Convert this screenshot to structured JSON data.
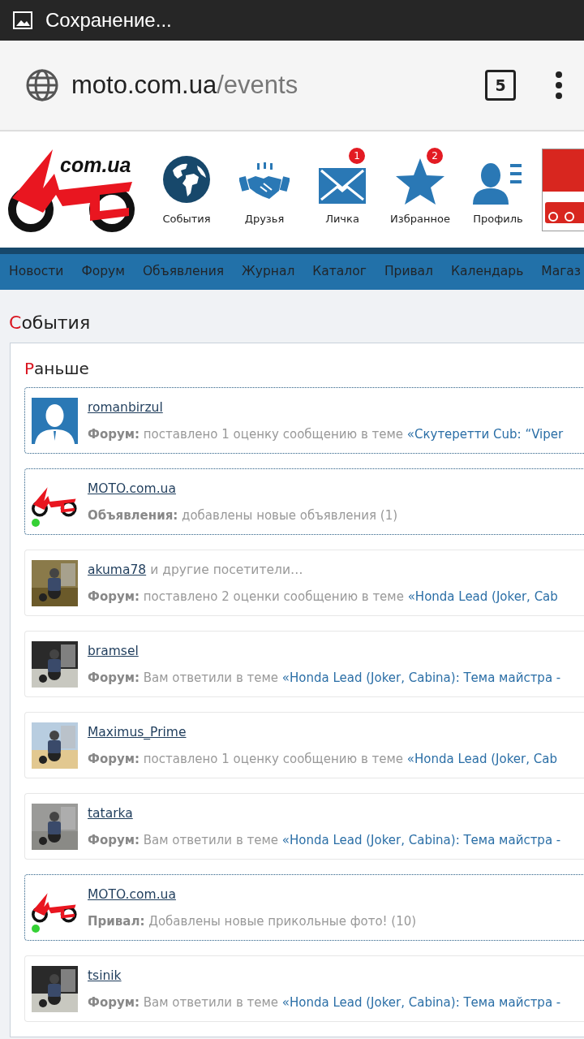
{
  "status_bar": {
    "title": "Сохранение..."
  },
  "address_bar": {
    "host": "moto.com.ua",
    "path": "/events",
    "tab_count": "5"
  },
  "header": {
    "logo_text": "com.ua",
    "items": [
      {
        "label": "События",
        "kind": "globe"
      },
      {
        "label": "Друзья",
        "kind": "handshake"
      },
      {
        "label": "Личка",
        "kind": "envelope",
        "badge": "1"
      },
      {
        "label": "Избранное",
        "kind": "star",
        "badge": "2"
      },
      {
        "label": "Профиль",
        "kind": "profile"
      }
    ]
  },
  "nav": [
    "Новости",
    "Форум",
    "Объявления",
    "Журнал",
    "Каталог",
    "Привал",
    "Календарь",
    "Магаз"
  ],
  "page_title": "События",
  "section_title": "Раньше",
  "events": [
    {
      "kind": "default",
      "online": false,
      "unread": true,
      "user": "romanbirzul",
      "category": "Форум:",
      "text": "поставлено 1 оценку сообщению в теме",
      "link": "«Скутеретти Cub: “Viper"
    },
    {
      "kind": "logo",
      "online": true,
      "unread": true,
      "user": "MOTO.com.ua",
      "category": "Объявления:",
      "text": "добавлены новые объявления (1)"
    },
    {
      "online": false,
      "unread": false,
      "user": "akuma78",
      "suffix": "и другие посетители…",
      "category": "Форум:",
      "text": "поставлено 2 оценки сообщению в теме",
      "link": "«Honda Lead (Joker, Cab"
    },
    {
      "online": false,
      "unread": false,
      "user": "bramsel",
      "category": "Форум:",
      "text": "Вам ответили в теме",
      "link": "«Honda Lead (Joker, Cabina): Тема майстра -"
    },
    {
      "online": false,
      "unread": false,
      "user": "Maximus_Prime",
      "category": "Форум:",
      "text": "поставлено 1 оценку сообщению в теме",
      "link": "«Honda Lead (Joker, Cab"
    },
    {
      "online": false,
      "unread": false,
      "user": "tatarka",
      "category": "Форум:",
      "text": "Вам ответили в теме",
      "link": "«Honda Lead (Joker, Cabina): Тема майстра -"
    },
    {
      "kind": "logo",
      "online": true,
      "unread": true,
      "user": "MOTO.com.ua",
      "category": "Привал:",
      "text": "Добавлены новые прикольные фото! (10)"
    },
    {
      "online": false,
      "unread": false,
      "user": "tsinik",
      "category": "Форум:",
      "text": "Вам ответили в теме",
      "link": "«Honda Lead (Joker, Cabina): Тема майстра -"
    }
  ]
}
